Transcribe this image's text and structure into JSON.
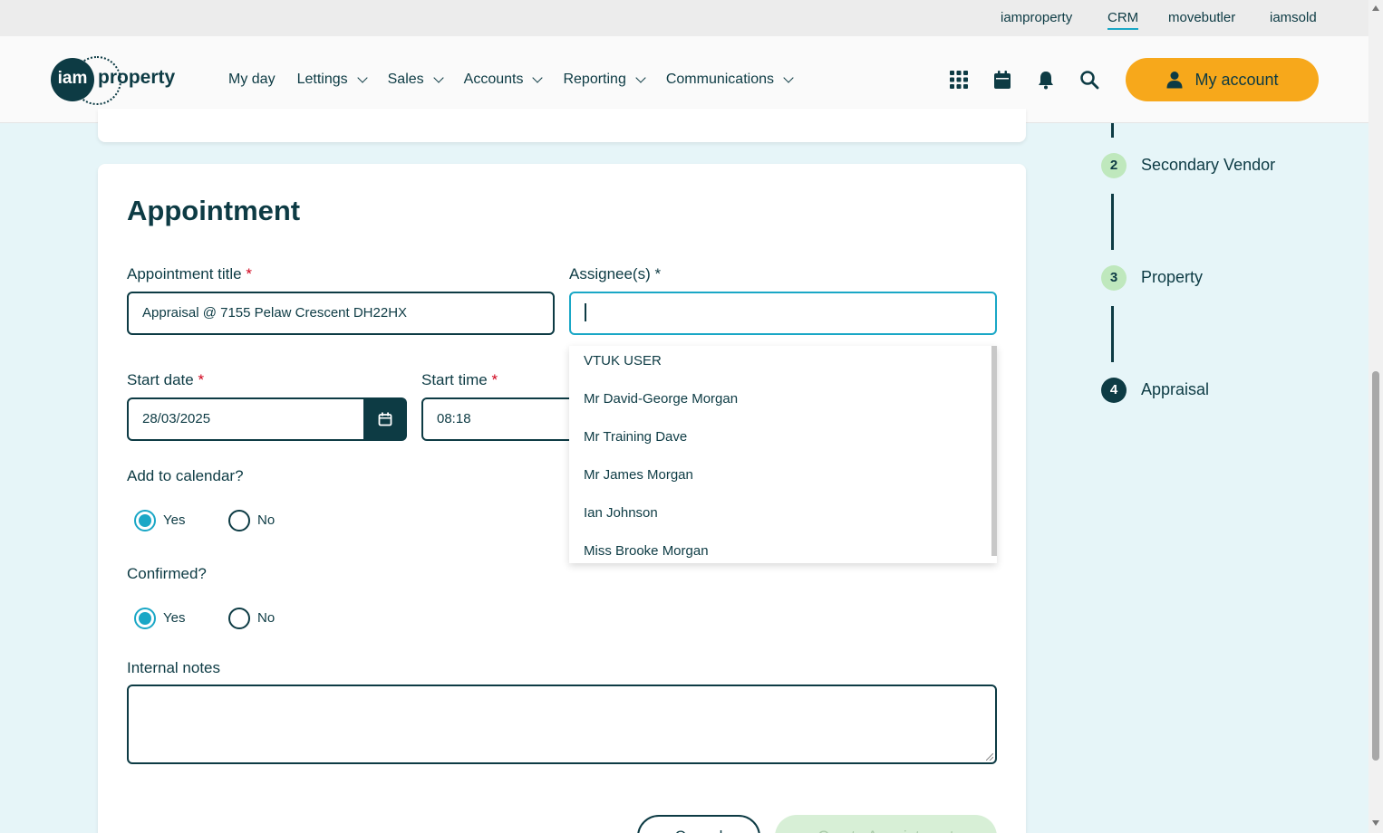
{
  "brand_bar": {
    "links": [
      "iamproperty",
      "CRM",
      "movebutler",
      "iamsold"
    ],
    "active": "CRM"
  },
  "header": {
    "logo_text_1": "iam",
    "logo_text_2": "property",
    "nav": [
      "My day",
      "Lettings",
      "Sales",
      "Accounts",
      "Reporting",
      "Communications"
    ],
    "account_label": "My account",
    "accent_color": "#f7a81b",
    "icons": [
      "apps-grid-icon",
      "calendar-icon",
      "bell-icon",
      "search-icon",
      "user-icon"
    ]
  },
  "form": {
    "heading": "Appointment",
    "title_label": "Appointment title",
    "title_value": "Appraisal @ 7155 Pelaw Crescent  DH22HX",
    "assignee_label": "Assignee(s)",
    "assignee_value": "",
    "start_date_label": "Start date",
    "start_date_value": "28/03/2025",
    "start_time_label": "Start time",
    "start_time_value": "08:18",
    "add_calendar_label": "Add to calendar?",
    "add_calendar_value": "Yes",
    "confirmed_label": "Confirmed?",
    "confirmed_value": "Yes",
    "yes_label": "Yes",
    "no_label": "No",
    "notes_label": "Internal notes",
    "cancel_label": "Cancel",
    "create_label": "Create Appointment"
  },
  "assignee_options": [
    "VTUK USER",
    "Mr David-George Morgan",
    "Mr Training Dave",
    "Mr James Morgan",
    "Ian Johnson",
    "Miss Brooke Morgan"
  ],
  "steps": [
    {
      "num": "2",
      "label": "Secondary Vendor",
      "state": "done"
    },
    {
      "num": "3",
      "label": "Property",
      "state": "done"
    },
    {
      "num": "4",
      "label": "Appraisal",
      "state": "current"
    }
  ]
}
